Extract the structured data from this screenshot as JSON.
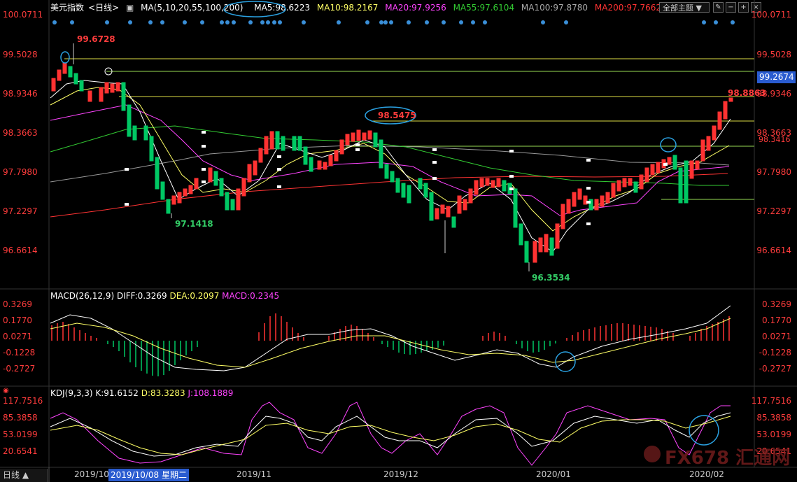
{
  "header": {
    "symbol": "美元指数",
    "period": "<日线>",
    "ma_params": "MA(5,10,20,55,100,200)",
    "ma5": "MA5:98.6223",
    "ma10": "MA10:98.2167",
    "ma20": "MA20:97.9256",
    "ma55": "MA55:97.6104",
    "ma100": "MA100:97.8780",
    "ma200": "MA200:97.7662",
    "theme_select": "全部主题"
  },
  "price_axis": {
    "right": [
      "100.0711",
      "99.5028",
      "98.9346",
      "98.3663",
      "97.7980",
      "97.2297",
      "96.6614"
    ],
    "left": [
      "100.0711",
      "99.5028",
      "98.9346",
      "98.3663",
      "97.7980",
      "97.2297",
      "96.6614"
    ],
    "current_box": "99.2674",
    "extra": "98.3416"
  },
  "annotations": {
    "high": "99.6728",
    "low1": "97.1418",
    "mid_high": "98.5475",
    "low2": "96.3534",
    "last": "98.8863"
  },
  "macd": {
    "title": "MACD(26,12,9)",
    "diff": "DIFF:0.3269",
    "dea": "DEA:0.2097",
    "macd": "MACD:0.2345",
    "axis": [
      "0.3269",
      "0.1770",
      "0.0271",
      "-0.1228",
      "-0.2727"
    ]
  },
  "kdj": {
    "title": "KDJ(9,3,3)",
    "k": "K:91.6152",
    "d": "D:83.3283",
    "j": "J:108.1889",
    "axis": [
      "117.7516",
      "85.3858",
      "53.0199",
      "20.6541"
    ]
  },
  "xaxis": {
    "period_button": "日线 ▲",
    "labels": [
      "2019/10",
      "2019/11",
      "2019/12",
      "2020/01",
      "2020/02"
    ],
    "cursor_label": "2019/10/08 星期二"
  },
  "watermark": "FX678 汇通网",
  "colors": {
    "bg": "#000000",
    "up": "#ff3232",
    "down": "#00c864",
    "ma5": "#ffffff",
    "ma10": "#ffff66",
    "ma20": "#ff33ff",
    "ma55": "#33cc33",
    "ma100": "#999999",
    "ma200": "#ff3333",
    "axis": "#ff3c3c",
    "hline": "#cccc33"
  }
}
